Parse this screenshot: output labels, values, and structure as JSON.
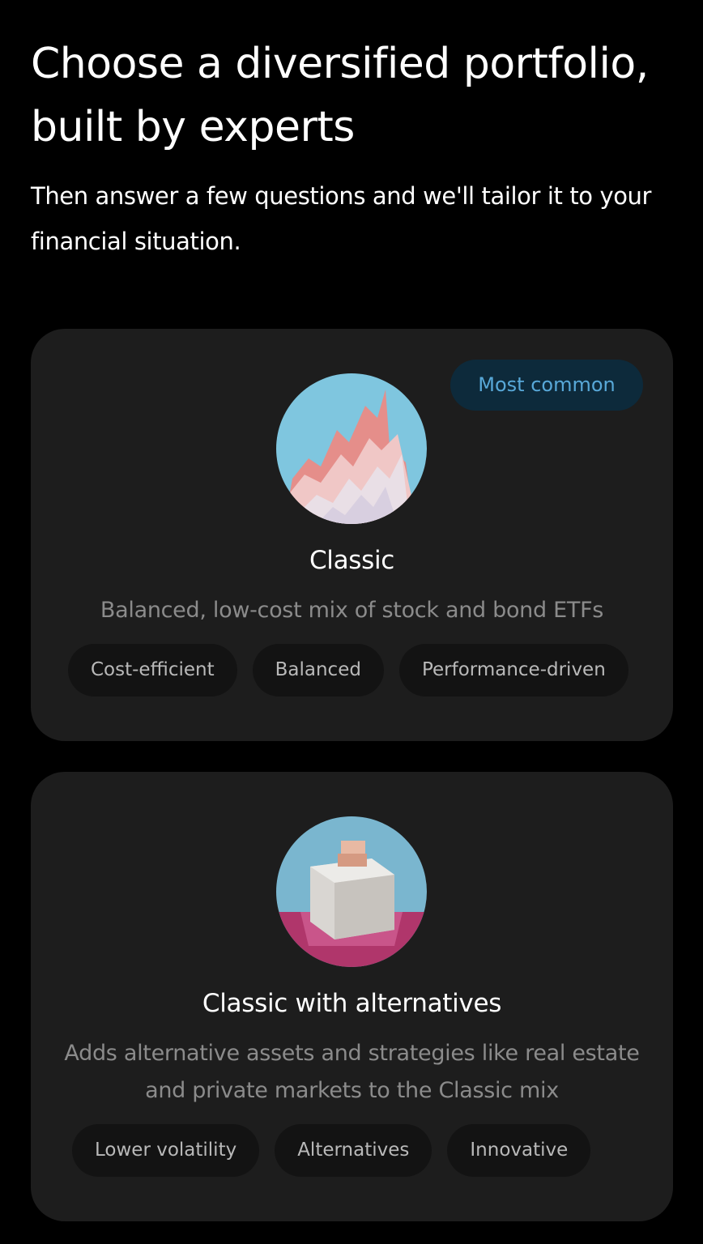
{
  "header": {
    "title": "Choose a diversified portfolio, built by experts",
    "subtitle": "Then answer a few questions and we'll tailor it to your financial situation."
  },
  "portfolios": [
    {
      "badge": "Most common",
      "title": "Classic",
      "description": "Balanced, low-cost mix of stock and bond ETFs",
      "tags": [
        "Cost-efficient",
        "Balanced",
        "Performance-driven"
      ]
    },
    {
      "title": "Classic with alternatives",
      "description": "Adds alternative assets and strategies like real estate and private markets to the Classic mix",
      "tags": [
        "Lower volatility",
        "Alternatives",
        "Innovative"
      ]
    }
  ],
  "colors": {
    "background": "#000000",
    "card": "#1d1d1d",
    "badge_bg": "#0d2a3b",
    "badge_text": "#58a8d8",
    "muted_text": "#8b8b8b"
  }
}
